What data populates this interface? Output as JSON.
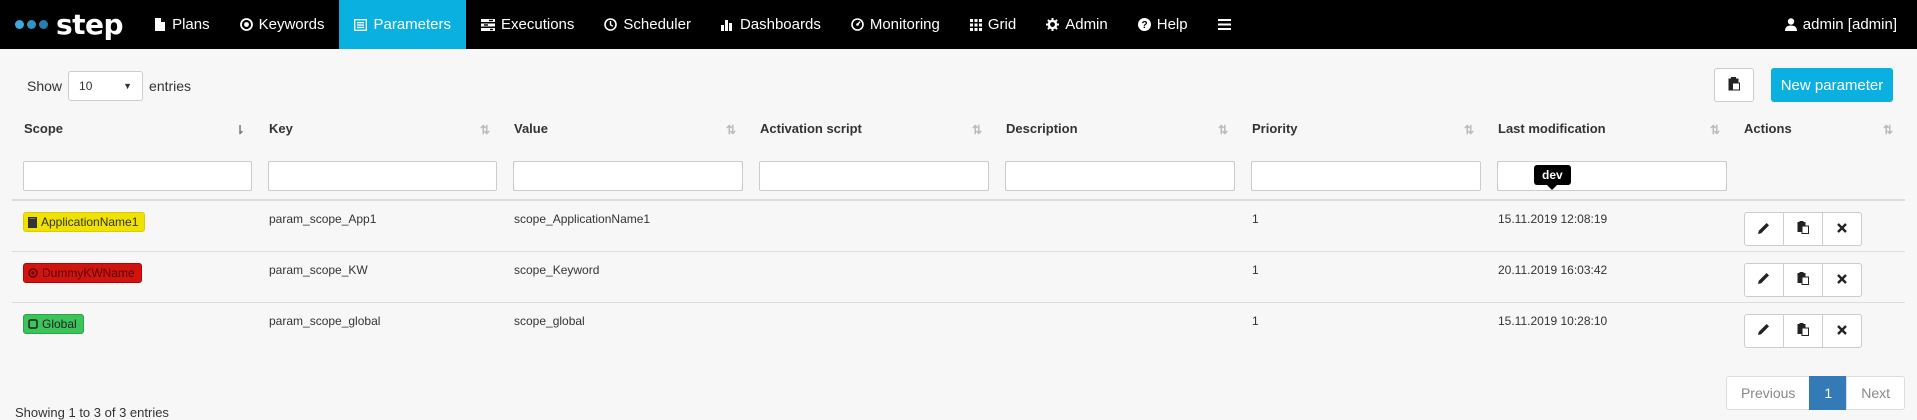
{
  "brand": {
    "name": "step"
  },
  "nav": {
    "items": [
      {
        "label": "Plans",
        "icon": "file-icon"
      },
      {
        "label": "Keywords",
        "icon": "dot-circle-icon"
      },
      {
        "label": "Parameters",
        "icon": "list-alt-icon",
        "active": true
      },
      {
        "label": "Executions",
        "icon": "tasks-icon"
      },
      {
        "label": "Scheduler",
        "icon": "clock-icon"
      },
      {
        "label": "Dashboards",
        "icon": "bar-chart-icon"
      },
      {
        "label": "Monitoring",
        "icon": "dashboard-icon"
      },
      {
        "label": "Grid",
        "icon": "grid-icon"
      },
      {
        "label": "Admin",
        "icon": "gear-icon"
      },
      {
        "label": "Help",
        "icon": "question-circle-icon"
      }
    ],
    "user": "admin [admin]"
  },
  "controls": {
    "show_label": "Show",
    "entries_label": "entries",
    "page_size": "10",
    "new_parameter_label": "New parameter"
  },
  "table": {
    "columns": [
      "Scope",
      "Key",
      "Value",
      "Activation script",
      "Description",
      "Priority",
      "Last modification",
      "Actions"
    ],
    "rows": [
      {
        "scope": "ApplicationName1",
        "scope_color": "yellow",
        "scope_icon": "book-icon",
        "key": "param_scope_App1",
        "value": "scope_ApplicationName1",
        "activation_script": "",
        "description": "",
        "priority": "1",
        "last_modification": "15.11.2019 12:08:19"
      },
      {
        "scope": "DummyKWName",
        "scope_color": "red",
        "scope_icon": "dot-circle-icon",
        "key": "param_scope_KW",
        "value": "scope_Keyword",
        "activation_script": "",
        "description": "",
        "priority": "1",
        "last_modification": "20.11.2019 16:03:42"
      },
      {
        "scope": "Global",
        "scope_color": "green",
        "scope_icon": "square-icon",
        "key": "param_scope_global",
        "value": "scope_global",
        "activation_script": "",
        "description": "",
        "priority": "1",
        "last_modification": "15.11.2019 10:28:10"
      }
    ]
  },
  "tooltip": {
    "text": "dev"
  },
  "footer": {
    "info": "Showing 1 to 3 of 3 entries",
    "previous": "Previous",
    "current_page": "1",
    "next": "Next"
  },
  "colors": {
    "navbar": "#000000",
    "accent": "#0ab0e0",
    "page_active": "#337ab7"
  }
}
